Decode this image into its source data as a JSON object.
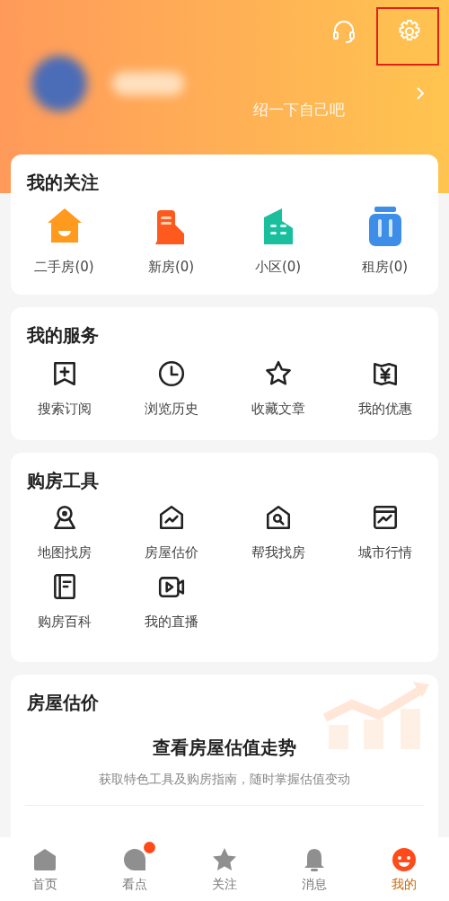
{
  "header": {
    "intro": "绍一下自己吧"
  },
  "follow": {
    "title": "我的关注",
    "items": [
      {
        "label": "二手房(0)",
        "kind": "house"
      },
      {
        "label": "新房(0)",
        "kind": "newbuild"
      },
      {
        "label": "小区(0)",
        "kind": "community"
      },
      {
        "label": "租房(0)",
        "kind": "rent"
      }
    ]
  },
  "services": {
    "title": "我的服务",
    "items": [
      {
        "label": "搜索订阅",
        "kind": "bookmark"
      },
      {
        "label": "浏览历史",
        "kind": "clock"
      },
      {
        "label": "收藏文章",
        "kind": "star"
      },
      {
        "label": "我的优惠",
        "kind": "coupon"
      }
    ]
  },
  "tools": {
    "title": "购房工具",
    "items": [
      {
        "label": "地图找房",
        "kind": "map"
      },
      {
        "label": "房屋估价",
        "kind": "house-chart"
      },
      {
        "label": "帮我找房",
        "kind": "house-search"
      },
      {
        "label": "城市行情",
        "kind": "chart"
      },
      {
        "label": "购房百科",
        "kind": "book"
      },
      {
        "label": "我的直播",
        "kind": "video"
      }
    ]
  },
  "valuation": {
    "title": "房屋估价",
    "headline": "查看房屋估值走势",
    "subtitle": "获取特色工具及购房指南，随时掌握估值变动"
  },
  "tabs": [
    {
      "label": "首页",
      "kind": "home",
      "selected": false,
      "badge": false
    },
    {
      "label": "看点",
      "kind": "bubble",
      "selected": false,
      "badge": true
    },
    {
      "label": "关注",
      "kind": "star",
      "selected": false,
      "badge": false
    },
    {
      "label": "消息",
      "kind": "bell",
      "selected": false,
      "badge": false
    },
    {
      "label": "我的",
      "kind": "face",
      "selected": true,
      "badge": false
    }
  ]
}
